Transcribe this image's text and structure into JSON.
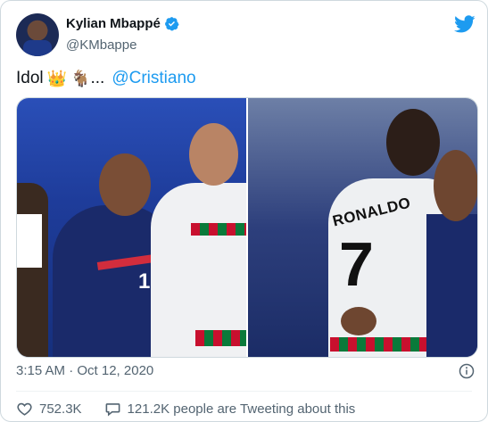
{
  "author": {
    "display_name": "Kylian Mbappé",
    "handle": "@KMbappe",
    "verified": true
  },
  "tweet": {
    "text": "Idol",
    "emoji": [
      "👑",
      "🐐"
    ],
    "ellipsis": "...",
    "mention": "@Cristiano"
  },
  "media": {
    "photo_count": 2,
    "jersey_name": "RONALDO",
    "jersey_number_right": "7",
    "jersey_number_left": "10"
  },
  "meta": {
    "timestamp": "3:15 AM · Oct 12, 2020"
  },
  "stats": {
    "likes": "752.3K",
    "tweeting_about": "121.2K people are Tweeting about this"
  },
  "colors": {
    "accent": "#1d9bf0",
    "secondary_text": "#536471",
    "border": "#cfd9de"
  }
}
